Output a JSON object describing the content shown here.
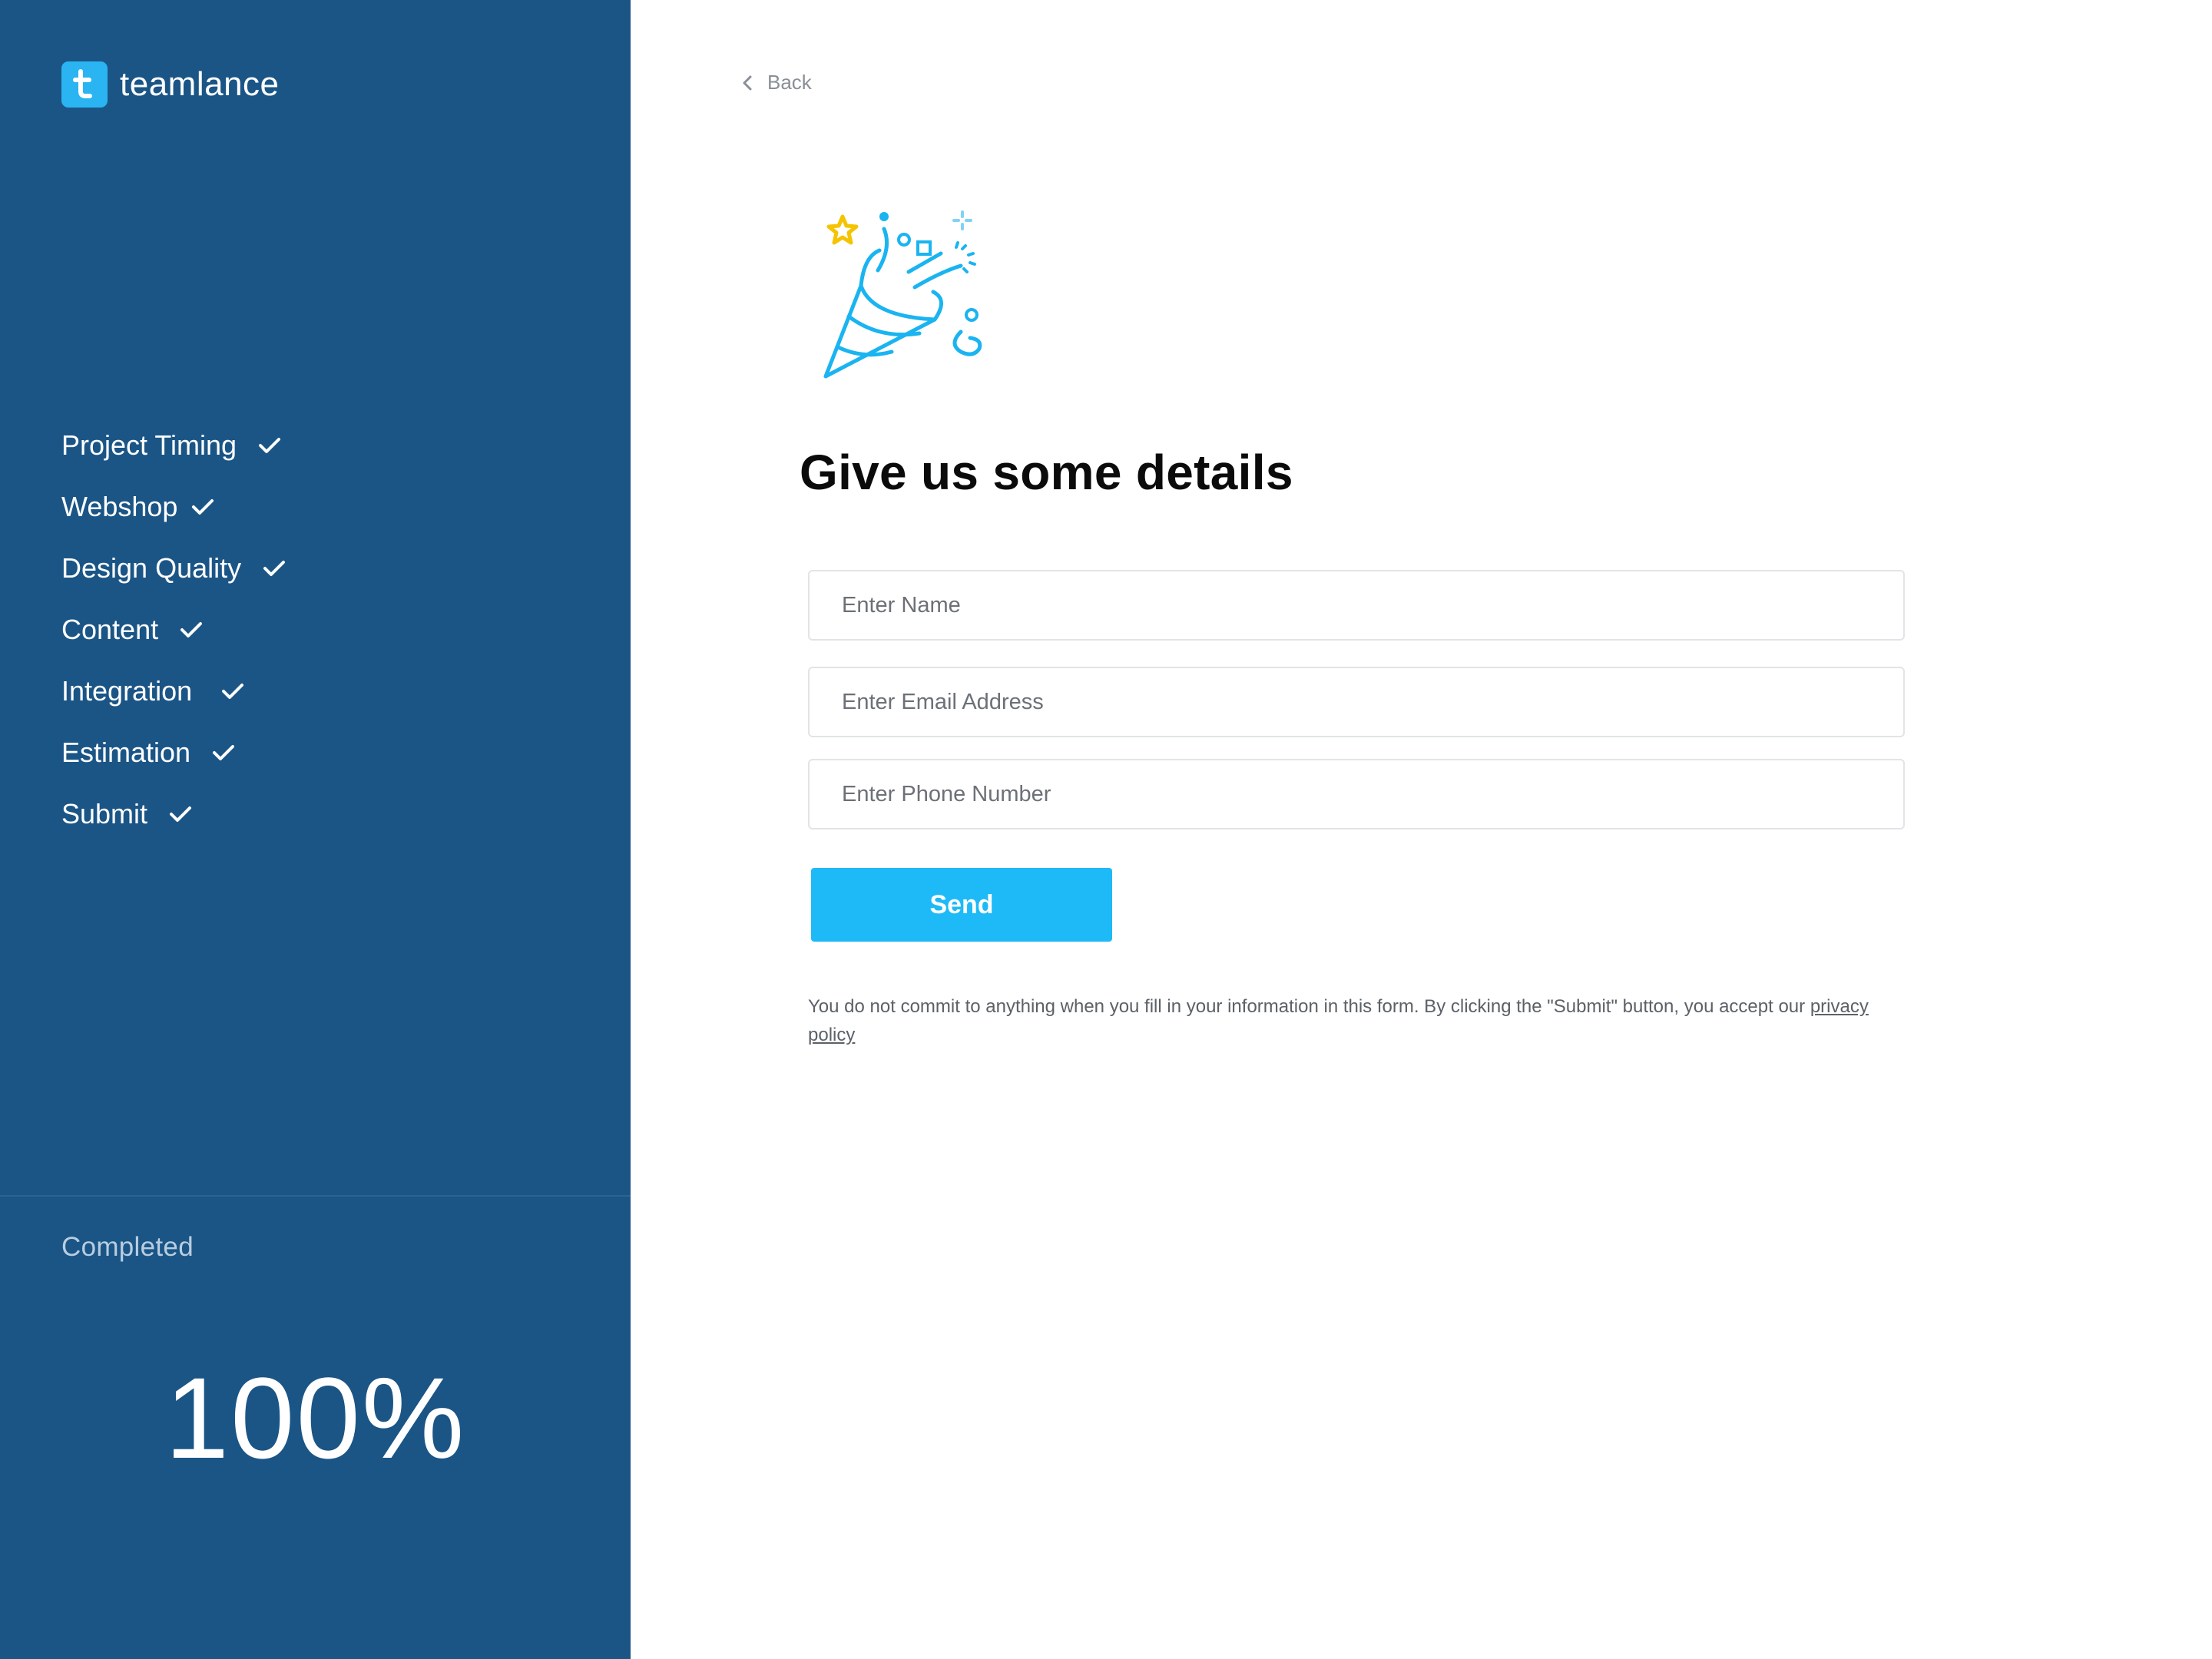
{
  "brand": {
    "name": "teamlance",
    "icon": "teamlance-logo-icon",
    "accent": "#2ab4f2"
  },
  "sidebar": {
    "background": "#1a5586",
    "steps": [
      {
        "label": "Project Timing",
        "status": "done"
      },
      {
        "label": "Webshop",
        "status": "done"
      },
      {
        "label": "Design Quality",
        "status": "done"
      },
      {
        "label": "Content",
        "status": "done"
      },
      {
        "label": "Integration",
        "status": "done"
      },
      {
        "label": "Estimation",
        "status": "done"
      },
      {
        "label": "Submit",
        "status": "done"
      }
    ],
    "completed_label": "Completed",
    "percent": "100%"
  },
  "main": {
    "back_label": "Back",
    "illustration": "party-popper-icon",
    "heading": "Give us some details",
    "form": {
      "name_placeholder": "Enter Name",
      "email_placeholder": "Enter Email Address",
      "phone_placeholder": "Enter Phone Number",
      "send_label": "Send",
      "send_color": "#1ebaf7"
    },
    "disclaimer": {
      "text": "You do not commit to anything when you fill in your information in this form. By clicking the \"Submit\" button, you accept our",
      "link": "privacy policy"
    }
  }
}
